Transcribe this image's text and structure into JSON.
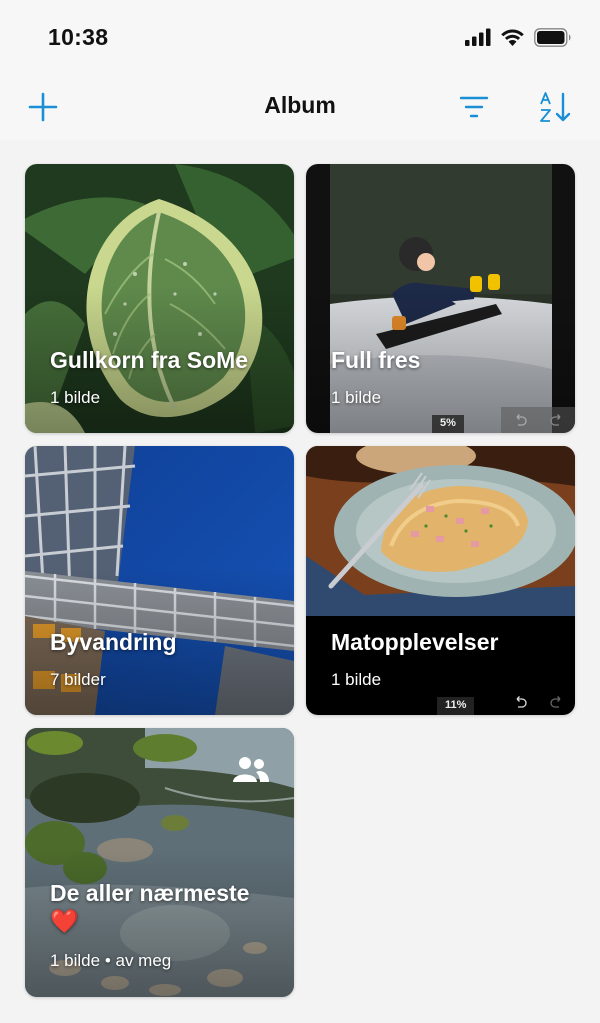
{
  "status_bar": {
    "time": "10:38"
  },
  "nav": {
    "title": "Album",
    "add_icon": "plus-icon",
    "filter_icon": "filter-icon",
    "sort_icon": "sort-az-icon",
    "accent": "#1a8fd6"
  },
  "albums": [
    {
      "title": "Gullkorn fra SoMe",
      "subtitle": "1 bilde",
      "image": "hosta-leaf-with-raindrops"
    },
    {
      "title": "Full fres",
      "subtitle": "1 bilde",
      "image": "child-on-snow-sled",
      "progress_label": "5%"
    },
    {
      "title": "Byvandring",
      "subtitle": "7 bilder",
      "image": "steel-glass-bridge-blue-sky"
    },
    {
      "title": "Matopplevelser",
      "subtitle": "1 bilde",
      "image": "omelette-on-plate",
      "progress_label": "11%"
    },
    {
      "title": "De aller nærmeste ❤️",
      "subtitle": "1 bilde • av meg",
      "image": "mossy-stones-in-stream",
      "shared_icon": "people-icon"
    }
  ]
}
